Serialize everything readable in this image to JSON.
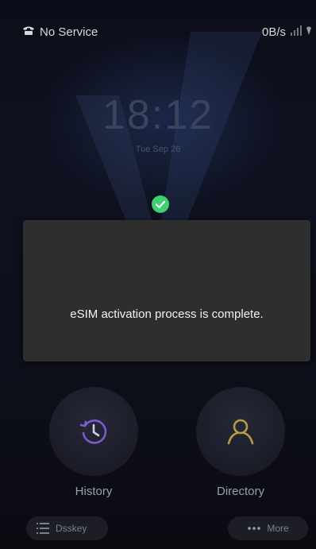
{
  "status_bar": {
    "carrier_icon": "phone-icon",
    "carrier_text": "No Service",
    "data_rate": "0B/s",
    "signal_icon": "signal-icon",
    "wifi_icon": "wifi-icon"
  },
  "lock_screen": {
    "time": "18:12",
    "date": "Tue Sep 26"
  },
  "toast": {
    "icon": "check-circle-icon",
    "message": "eSIM activation process is complete.",
    "accent": "#3ecf6e"
  },
  "actions": [
    {
      "label": "History",
      "icon": "history-icon",
      "color": "#7b5bd0"
    },
    {
      "label": "Directory",
      "icon": "contact-icon",
      "color": "#b99a45"
    }
  ],
  "bottom_bar": {
    "dsskey_label": "Dsskey",
    "dsskey_icon": "list-icon",
    "more_label": "More",
    "more_icon": "more-dots-icon"
  }
}
